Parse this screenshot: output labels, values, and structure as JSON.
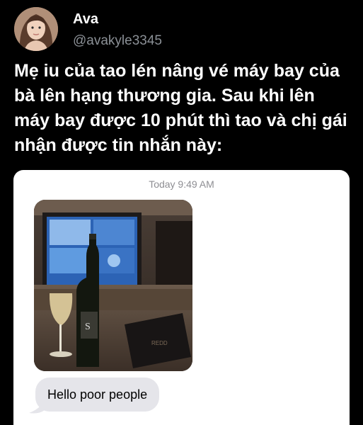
{
  "tweet": {
    "author": {
      "display_name": "Ava",
      "handle": "@avakyle3345"
    },
    "text": "Mẹ iu của tao lén nâng vé máy bay của bà lên hạng thương gia. Sau khi lên máy bay được 10 phút thì tao và chị gái nhận được tin nhắn này:"
  },
  "message_screenshot": {
    "timestamp": "Today 9:49 AM",
    "message_text": "Hello poor people"
  },
  "colors": {
    "background": "#000000",
    "handle": "#8b9096",
    "bubble": "#e5e5ea",
    "timestamp": "#8e8e93"
  }
}
